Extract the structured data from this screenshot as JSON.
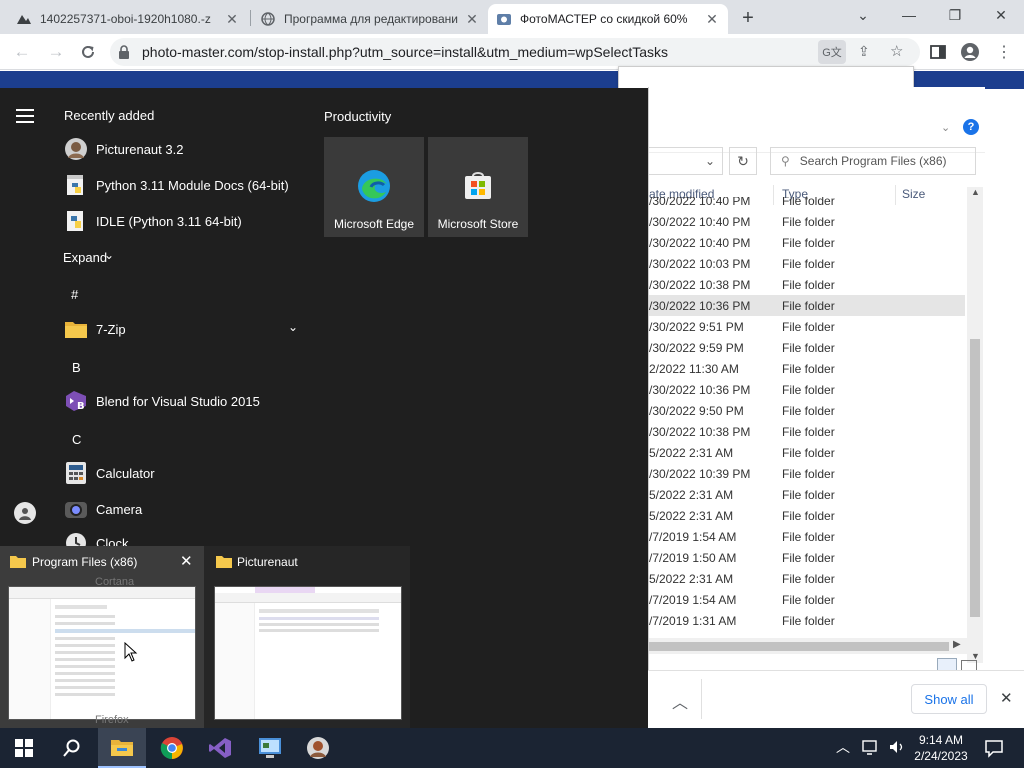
{
  "browser": {
    "tabs": [
      {
        "label": "1402257371-oboi-1920h1080.-z",
        "icon": "image-icon"
      },
      {
        "label": "Программа для редактировани",
        "icon": "globe-icon"
      },
      {
        "label": "ФотоМАСТЕР со скидкой 60%",
        "icon": "photomaster-icon"
      }
    ],
    "new_tab": "+",
    "url": "photo-master.com/stop-install.php?utm_source=install&utm_medium=wpSelectTasks"
  },
  "explorer": {
    "search_placeholder": "Search Program Files (x86)",
    "columns": {
      "date": "ate modified",
      "type": "Type",
      "size": "Size"
    },
    "rows": [
      {
        "date": "/30/2022 10:40 PM",
        "type": "File folder"
      },
      {
        "date": "/30/2022 10:40 PM",
        "type": "File folder"
      },
      {
        "date": "/30/2022 10:40 PM",
        "type": "File folder"
      },
      {
        "date": "/30/2022 10:03 PM",
        "type": "File folder"
      },
      {
        "date": "/30/2022 10:38 PM",
        "type": "File folder"
      },
      {
        "date": "/30/2022 10:36 PM",
        "type": "File folder",
        "selected": true
      },
      {
        "date": "/30/2022 9:51 PM",
        "type": "File folder"
      },
      {
        "date": "/30/2022 9:59 PM",
        "type": "File folder"
      },
      {
        "date": "2/2022 11:30 AM",
        "type": "File folder"
      },
      {
        "date": "/30/2022 10:36 PM",
        "type": "File folder"
      },
      {
        "date": "/30/2022 9:50 PM",
        "type": "File folder"
      },
      {
        "date": "/30/2022 10:38 PM",
        "type": "File folder"
      },
      {
        "date": "5/2022 2:31 AM",
        "type": "File folder"
      },
      {
        "date": "/30/2022 10:39 PM",
        "type": "File folder"
      },
      {
        "date": "5/2022 2:31 AM",
        "type": "File folder"
      },
      {
        "date": "5/2022 2:31 AM",
        "type": "File folder"
      },
      {
        "date": "/7/2019 1:54 AM",
        "type": "File folder"
      },
      {
        "date": "/7/2019 1:50 AM",
        "type": "File folder"
      },
      {
        "date": "5/2022 2:31 AM",
        "type": "File folder"
      },
      {
        "date": "/7/2019 1:54 AM",
        "type": "File folder"
      },
      {
        "date": "/7/2019 1:31 AM",
        "type": "File folder"
      }
    ],
    "show_all": "Show all"
  },
  "start_menu": {
    "recently_added": "Recently added",
    "recent_apps": [
      {
        "label": "Picturenaut 3.2",
        "icon": "picturenaut-icon"
      },
      {
        "label": "Python 3.11 Module Docs (64-bit)",
        "icon": "python-docs-icon"
      },
      {
        "label": "IDLE (Python 3.11 64-bit)",
        "icon": "python-idle-icon"
      }
    ],
    "expand": "Expand",
    "groups": [
      {
        "letter": "#",
        "apps": [
          {
            "label": "7-Zip",
            "icon": "folder-icon",
            "has_children": true
          }
        ]
      },
      {
        "letter": "B",
        "apps": [
          {
            "label": "Blend for Visual Studio 2015",
            "icon": "blend-icon"
          }
        ]
      },
      {
        "letter": "C",
        "apps": [
          {
            "label": "Calculator",
            "icon": "calculator-icon"
          },
          {
            "label": "Camera",
            "icon": "camera-icon"
          },
          {
            "label": "Clock",
            "icon": "clock-icon"
          }
        ]
      }
    ],
    "hidden_labels": [
      "Cortana",
      "Firefox"
    ],
    "productivity": "Productivity",
    "tiles": [
      {
        "label": "Microsoft Edge",
        "icon": "edge-icon"
      },
      {
        "label": "Microsoft Store",
        "icon": "store-icon"
      }
    ]
  },
  "thumbnails": [
    {
      "title": "Program Files (x86)",
      "icon": "folder-icon"
    },
    {
      "title": "Picturenaut",
      "icon": "folder-icon"
    }
  ],
  "taskbar": {
    "time": "9:14 AM",
    "date": "2/24/2023",
    "apps": [
      "file-explorer-icon",
      "chrome-icon",
      "visual-studio-icon",
      "control-panel-icon",
      "picturenaut-icon"
    ]
  },
  "colors": {
    "accent": "#1a73e8",
    "taskbar": "#1b2433",
    "start_bg": "#1f1f1f"
  }
}
